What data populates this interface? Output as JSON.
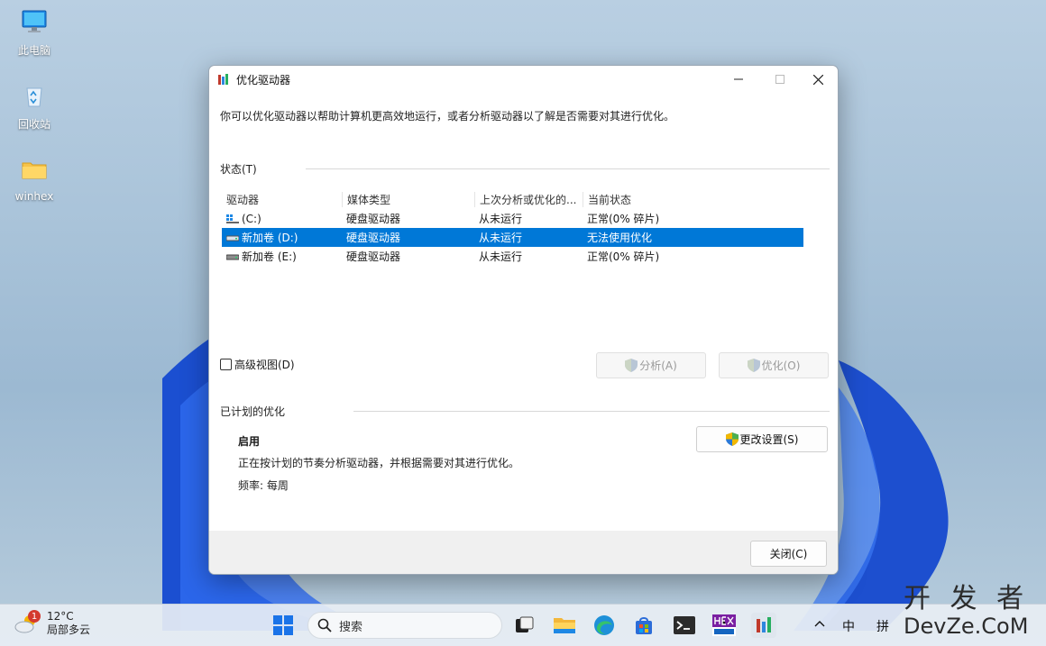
{
  "desktop": {
    "icons": [
      {
        "label": "此电脑",
        "icon": "computer-icon"
      },
      {
        "label": "回收站",
        "icon": "recycle-bin-icon"
      },
      {
        "label": "winhex",
        "icon": "folder-icon"
      }
    ]
  },
  "window": {
    "title": "优化驱动器",
    "intro": "你可以优化驱动器以帮助计算机更高效地运行，或者分析驱动器以了解是否需要对其进行优化。",
    "status_label": "状态(T)",
    "columns": [
      "驱动器",
      "媒体类型",
      "上次分析或优化的...",
      "当前状态"
    ],
    "drives": [
      {
        "name": "(C:)",
        "media": "硬盘驱动器",
        "last_run": "从未运行",
        "status": "正常(0% 碎片)",
        "icon": "windows-drive-icon",
        "selected": false
      },
      {
        "name": "新加卷 (D:)",
        "media": "硬盘驱动器",
        "last_run": "从未运行",
        "status": "无法使用优化",
        "icon": "drive-icon",
        "selected": true
      },
      {
        "name": "新加卷 (E:)",
        "media": "硬盘驱动器",
        "last_run": "从未运行",
        "status": "正常(0% 碎片)",
        "icon": "drive-icon",
        "selected": false
      }
    ],
    "advanced_view_label": "高级视图(D)",
    "analyze_label": "分析(A)",
    "optimize_label": "优化(O)",
    "scheduled_label": "已计划的优化",
    "schedule": {
      "state": "启用",
      "description": "正在按计划的节奏分析驱动器，并根据需要对其进行优化。",
      "frequency": "频率: 每周"
    },
    "change_settings_label": "更改设置(S)",
    "close_label": "关闭(C)"
  },
  "taskbar": {
    "weather": {
      "badge": "1",
      "temp": "12°C",
      "condition": "局部多云"
    },
    "search_placeholder": "搜索",
    "apps": [
      "start-icon",
      "task-view-icon",
      "file-explorer-icon",
      "edge-icon",
      "store-icon",
      "terminal-icon",
      "hex-editor-icon",
      "defrag-app-icon"
    ],
    "tray": {
      "ime1": "中",
      "ime2": "拼"
    }
  },
  "watermark": {
    "line1": "开 发 者",
    "line2": "DevZe.CoM"
  },
  "colors": {
    "selection": "#0078d7",
    "accent": "#0067c0"
  }
}
